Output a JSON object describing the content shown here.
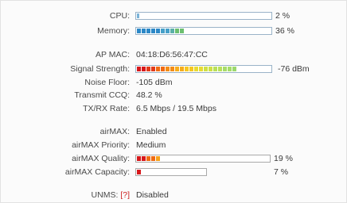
{
  "status": {
    "cpu": {
      "label": "CPU:",
      "value_text": "2 %",
      "percent": 2
    },
    "memory": {
      "label": "Memory:",
      "value_text": "36 %",
      "percent": 36
    },
    "ap_mac": {
      "label": "AP MAC:",
      "value": "04:18:D6:56:47:CC"
    },
    "signal": {
      "label": "Signal Strength:",
      "value_text": "-76 dBm",
      "level": 0.75
    },
    "noise": {
      "label": "Noise Floor:",
      "value": "-105 dBm"
    },
    "ccq": {
      "label": "Transmit CCQ:",
      "value": "48.2 %"
    },
    "rate": {
      "label": "TX/RX Rate:",
      "value": "6.5 Mbps / 19.5 Mbps"
    }
  },
  "airmax": {
    "airmax": {
      "label": "airMAX:",
      "value": "Enabled"
    },
    "priority": {
      "label": "airMAX Priority:",
      "value": "Medium"
    },
    "quality": {
      "label": "airMAX Quality:",
      "value_text": "19 %",
      "percent": 19
    },
    "capacity": {
      "label": "airMAX Capacity:",
      "value_text": "7 %",
      "percent": 7
    }
  },
  "unms": {
    "label": "UNMS:",
    "help": "[?]",
    "value": "Disabled"
  },
  "colors": {
    "cpu_fill": "#7ab3d8",
    "memory_fill": [
      "#2c88c7",
      "#2c88c7",
      "#2c88c7",
      "#2c88c7",
      "#46a0c9",
      "#5bb0a8",
      "#6cbf70",
      "#6cbf70"
    ],
    "signal_fill": [
      "#d7191c",
      "#e23b1a",
      "#ef6a13",
      "#f38d17",
      "#f6ad1c",
      "#f6c723",
      "#e7db34",
      "#cfe046",
      "#b8e05a",
      "#a6dc6a",
      "#9bd86e"
    ],
    "quality_fill": [
      "#d7191c",
      "#ef6a13",
      "#f6a21c"
    ],
    "capacity_fill": "#d7191c"
  }
}
